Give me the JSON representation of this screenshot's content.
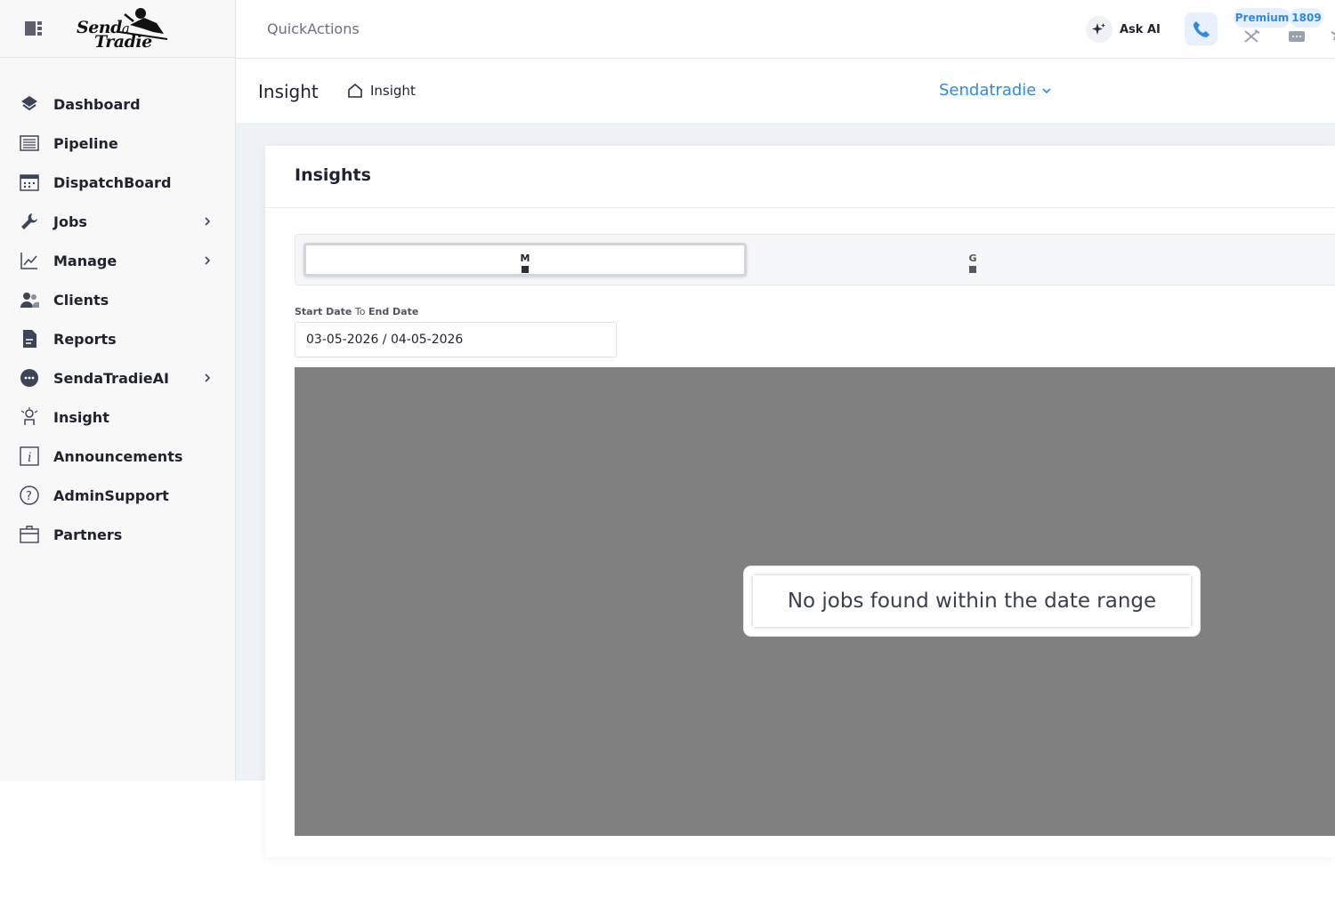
{
  "brand": {
    "line1": "Send",
    "line1b": "a",
    "line2": "Tradie"
  },
  "sidebar": {
    "items": [
      {
        "label": "Dashboard",
        "icon": "dashboard-icon",
        "chevron": false
      },
      {
        "label": "Pipeline",
        "icon": "pipeline-icon",
        "chevron": false
      },
      {
        "label": "DispatchBoard",
        "icon": "calendar-icon",
        "chevron": false
      },
      {
        "label": "Jobs",
        "icon": "wrench-icon",
        "chevron": true
      },
      {
        "label": "Manage",
        "icon": "chart-icon",
        "chevron": true
      },
      {
        "label": "Clients",
        "icon": "users-icon",
        "chevron": false
      },
      {
        "label": "Reports",
        "icon": "report-icon",
        "chevron": false
      },
      {
        "label": "SendaTradieAI",
        "icon": "chat-icon",
        "chevron": true
      },
      {
        "label": "Insight",
        "icon": "insight-icon",
        "chevron": false
      },
      {
        "label": "Announcements",
        "icon": "info-icon",
        "chevron": false
      },
      {
        "label": "AdminSupport",
        "icon": "help-icon",
        "chevron": false
      },
      {
        "label": "Partners",
        "icon": "briefcase-icon",
        "chevron": false
      }
    ]
  },
  "topbar": {
    "quick_actions": "QuickActions",
    "ask_ai": "Ask AI",
    "plan": "Premium",
    "count": "1809"
  },
  "page": {
    "title": "Insight",
    "breadcrumb": "Insight",
    "company": "Sendatradie"
  },
  "card": {
    "title": "Insights",
    "tabs": [
      {
        "label": "M"
      },
      {
        "label": "G"
      }
    ],
    "date_label_start": "Start Date",
    "date_label_to": " To ",
    "date_label_end": "End Date",
    "date_value": "03-05-2026 / 04-05-2026",
    "empty_message": "No jobs found within the date range"
  },
  "colors": {
    "accent": "#2e8ae6",
    "overlay": "#808080",
    "sidebar_bg": "#f8f8f9",
    "content_bg": "#eef1f6"
  }
}
